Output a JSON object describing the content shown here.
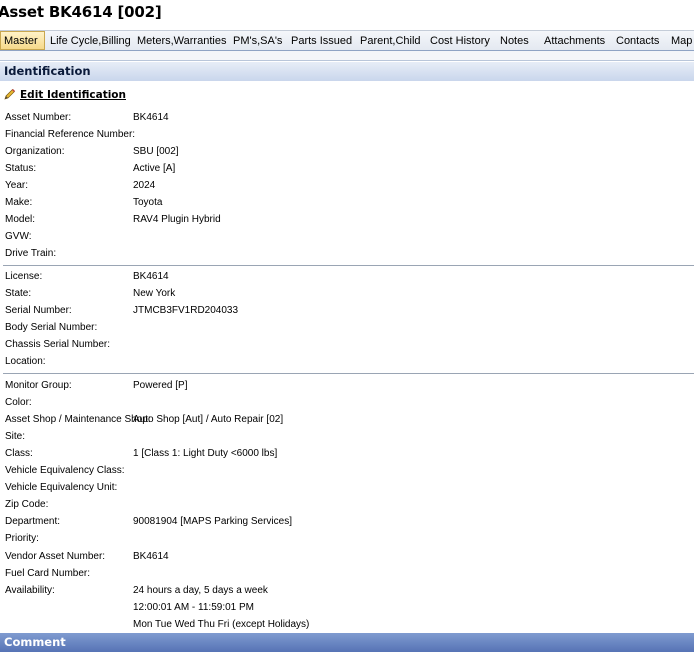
{
  "page": {
    "title": "Asset BK4614 [002]"
  },
  "tabs": [
    {
      "label": "Master",
      "active": true
    },
    {
      "label": "Life Cycle,Billing",
      "active": false
    },
    {
      "label": "Meters,Warranties",
      "active": false
    },
    {
      "label": "PM's,SA's",
      "active": false
    },
    {
      "label": "Parts Issued",
      "active": false
    },
    {
      "label": "Parent,Child",
      "active": false
    },
    {
      "label": "Cost History",
      "active": false
    },
    {
      "label": "Notes",
      "active": false
    },
    {
      "label": "Attachments",
      "active": false
    },
    {
      "label": "Contacts",
      "active": false
    },
    {
      "label": "Map",
      "active": false
    }
  ],
  "identification": {
    "header": "Identification",
    "edit_link": "Edit Identification",
    "edit_icon": "pencil-icon",
    "group1": [
      {
        "label": "Asset Number:",
        "value": "BK4614"
      },
      {
        "label": "Financial Reference Number:",
        "value": ""
      },
      {
        "label": "Organization:",
        "value": "SBU [002]"
      },
      {
        "label": "Status:",
        "value": "Active [A]"
      },
      {
        "label": "Year:",
        "value": "2024"
      },
      {
        "label": "Make:",
        "value": "Toyota"
      },
      {
        "label": "Model:",
        "value": "RAV4 Plugin Hybrid"
      },
      {
        "label": "GVW:",
        "value": ""
      },
      {
        "label": "Drive Train:",
        "value": ""
      }
    ],
    "group2": [
      {
        "label": "License:",
        "value": "BK4614"
      },
      {
        "label": "State:",
        "value": "New York"
      },
      {
        "label": "Serial Number:",
        "value": "JTMCB3FV1RD204033"
      },
      {
        "label": "Body Serial Number:",
        "value": ""
      },
      {
        "label": "Chassis Serial Number:",
        "value": ""
      },
      {
        "label": "Location:",
        "value": ""
      }
    ],
    "group3": [
      {
        "label": "Monitor Group:",
        "value": "Powered [P]"
      },
      {
        "label": "Color:",
        "value": ""
      },
      {
        "label": "Asset Shop / Maintenance Shop:",
        "value": "Auto Shop [Aut] / Auto Repair [02]"
      },
      {
        "label": "Site:",
        "value": ""
      },
      {
        "label": "Class:",
        "value": "1 [Class 1: Light Duty <6000 lbs]"
      },
      {
        "label": "Vehicle Equivalency Class:",
        "value": ""
      },
      {
        "label": "Vehicle Equivalency Unit:",
        "value": ""
      },
      {
        "label": "Zip Code:",
        "value": ""
      },
      {
        "label": "Department:",
        "value": "90081904 [MAPS Parking Services]"
      },
      {
        "label": "Priority:",
        "value": ""
      },
      {
        "label": "Vendor Asset Number:",
        "value": "BK4614"
      },
      {
        "label": "Fuel Card Number:",
        "value": ""
      },
      {
        "label": "Availability:",
        "value": "24 hours a day, 5 days a week"
      },
      {
        "label": "",
        "value": "12:00:01 AM - 11:59:01 PM"
      },
      {
        "label": "",
        "value": "Mon Tue Wed Thu Fri (except Holidays)"
      }
    ]
  },
  "comment": {
    "header": "Comment"
  }
}
